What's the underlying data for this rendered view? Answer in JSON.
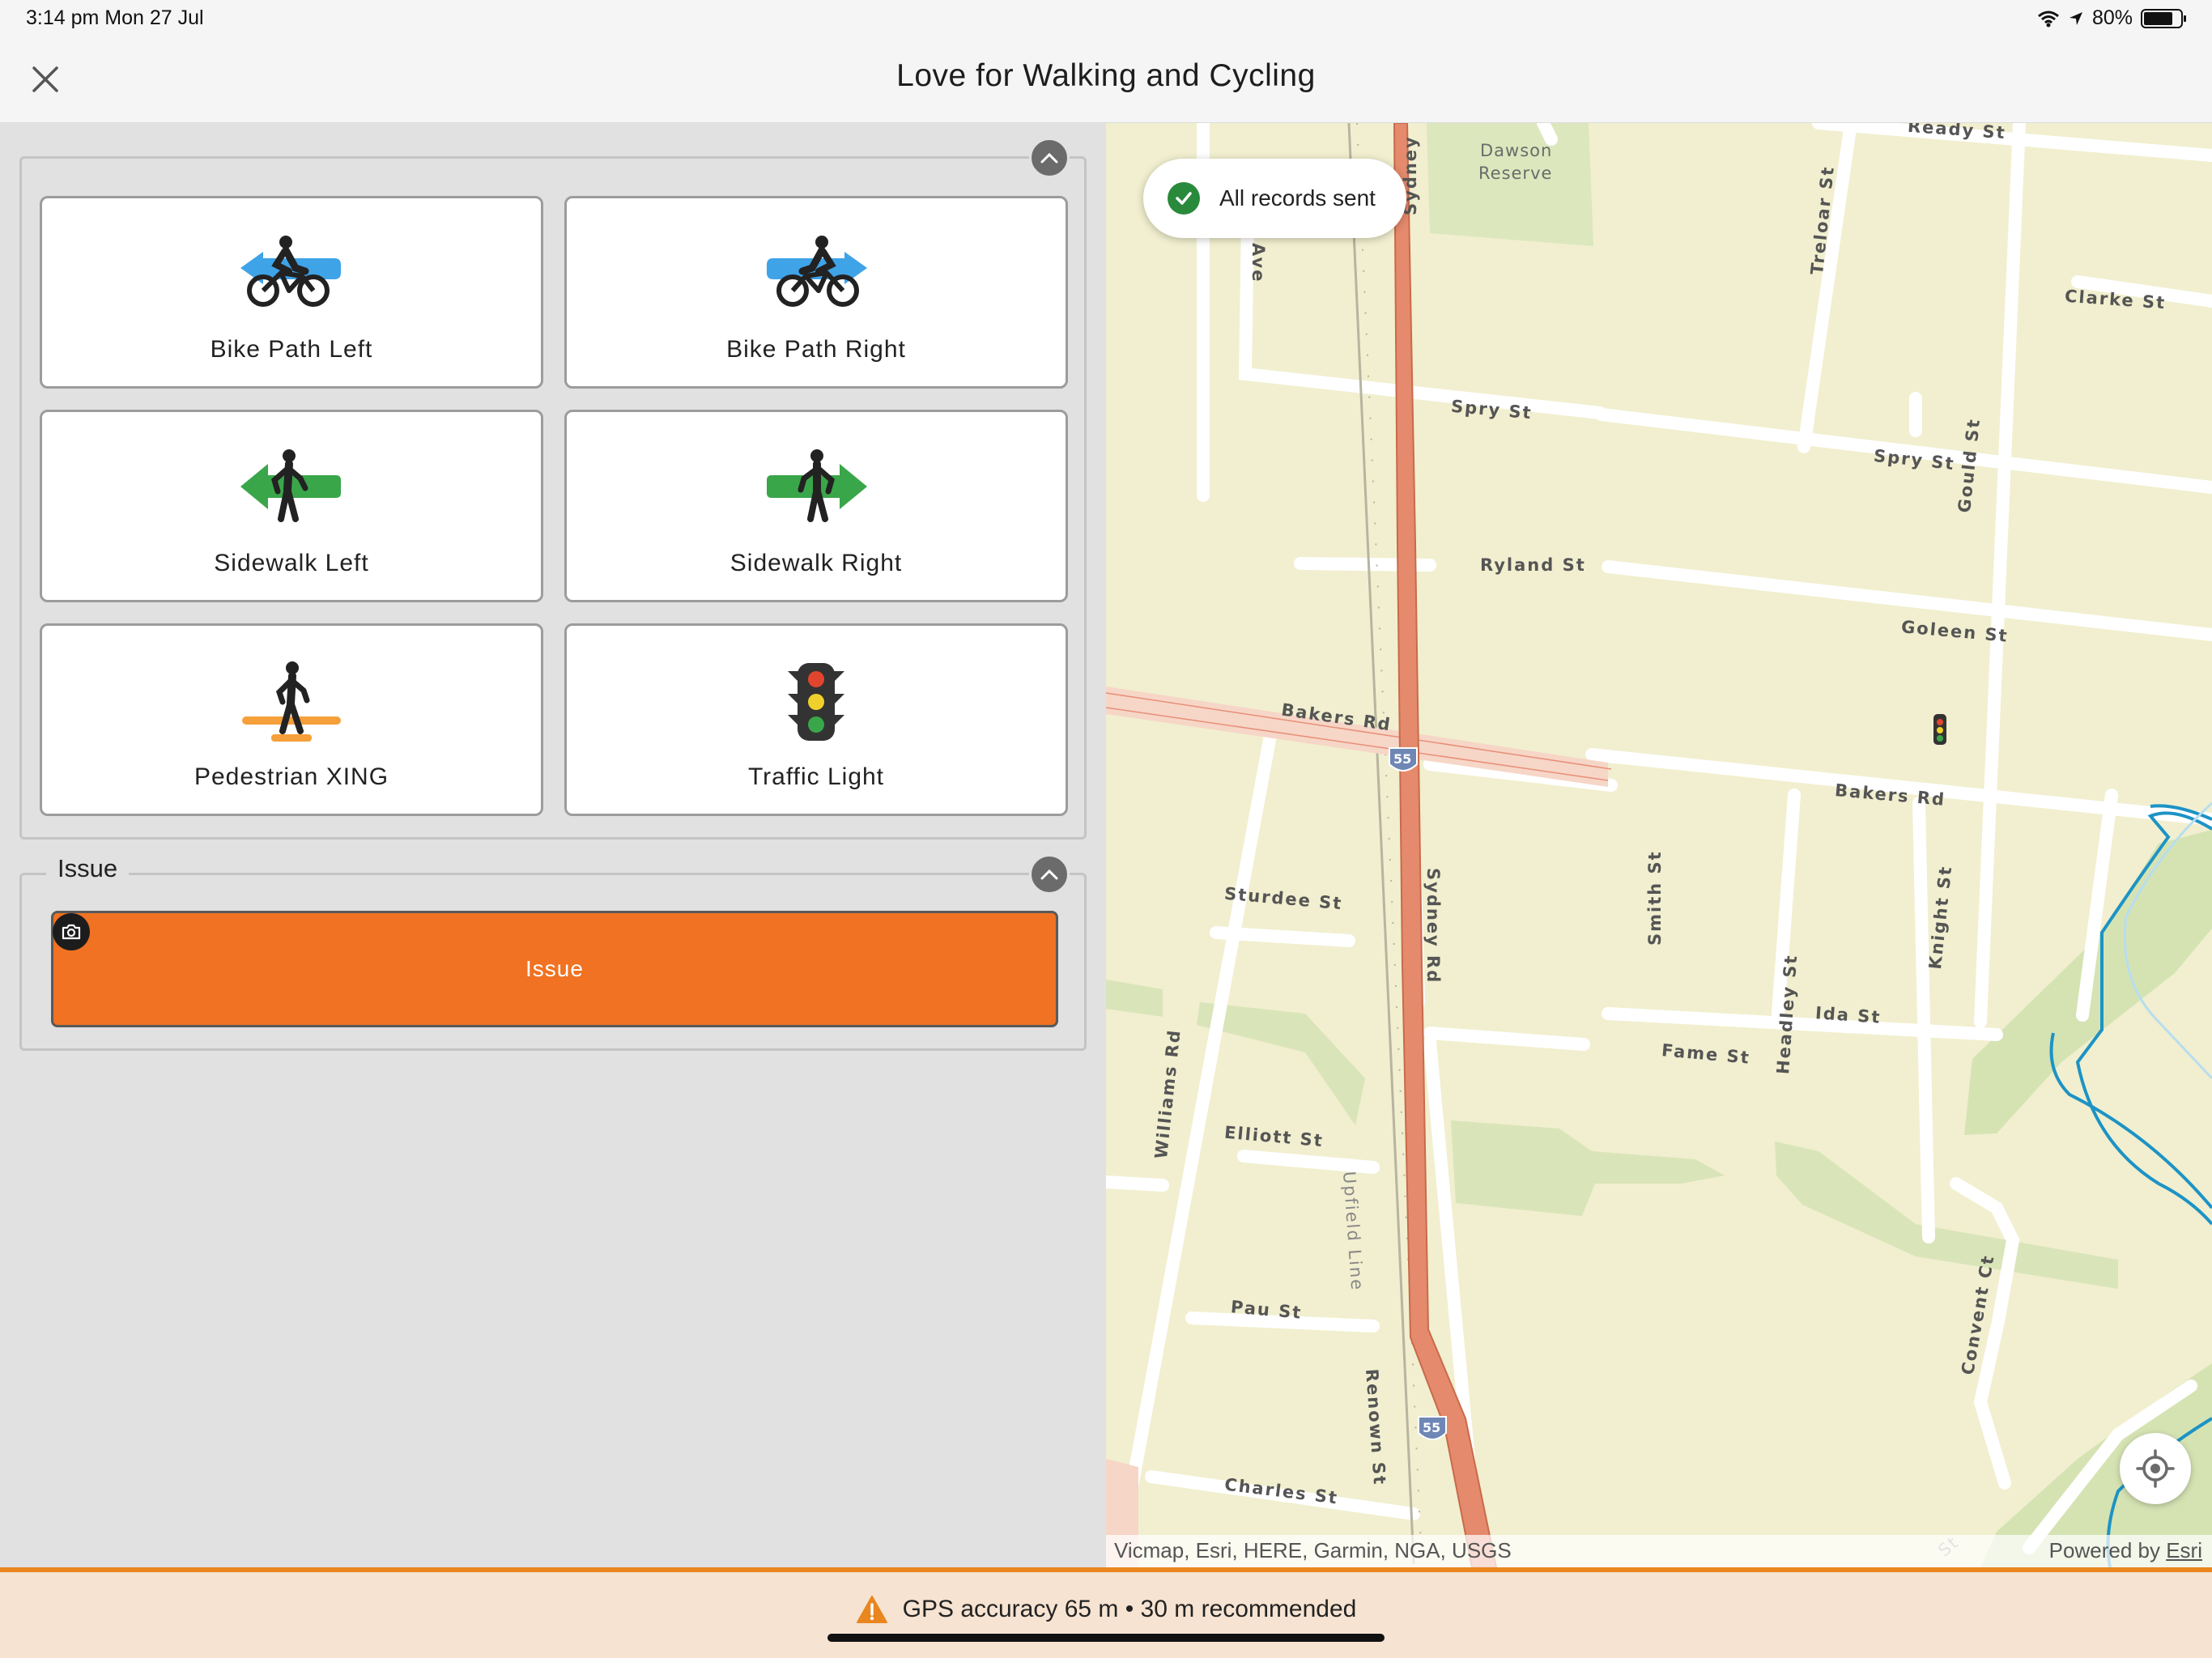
{
  "status_bar": {
    "time": "3:14 pm   Mon 27 Jul",
    "battery_text": "80%",
    "battery_level": 0.8
  },
  "header": {
    "title": "Love for Walking and Cycling",
    "close_icon": "close-icon"
  },
  "form": {
    "group1": {
      "tiles": [
        {
          "label": "Bike Path Left",
          "icon": "bike-path-left-icon"
        },
        {
          "label": "Bike Path Right",
          "icon": "bike-path-right-icon"
        },
        {
          "label": "Sidewalk Left",
          "icon": "sidewalk-left-icon"
        },
        {
          "label": "Sidewalk Right",
          "icon": "sidewalk-right-icon"
        },
        {
          "label": "Pedestrian XING",
          "icon": "pedestrian-crossing-icon"
        },
        {
          "label": "Traffic Light",
          "icon": "traffic-light-icon"
        }
      ]
    },
    "group2": {
      "title": "Issue",
      "button_label": "Issue"
    }
  },
  "map": {
    "toast": "All records sent",
    "attribution": "Vicmap, Esri, HERE, Garmin, NGA, USGS",
    "powered_by": "Powered by",
    "powered_by_link": "Esri",
    "labels": {
      "dawson": "Dawson",
      "reserve": "Reserve",
      "ready_st": "Ready St",
      "clarke_st": "Clarke St",
      "treloar_st": "Treloar St",
      "spry_st_1": "Spry St",
      "spry_st_2": "Spry St",
      "gould_st": "Gould St",
      "ryland_st": "Ryland St",
      "goleen_st": "Goleen St",
      "bakers_rd_1": "Bakers Rd",
      "bakers_rd_2": "Bakers Rd",
      "sydney_top": "Sydney",
      "sydney_rd": "Sydney Rd",
      "ave": "Ave",
      "sturdee_st": "Sturdee St",
      "smith_st": "Smith St",
      "knight_st": "Knight St",
      "headley_st": "Headley St",
      "ida_st": "Ida St",
      "fame_st": "Fame St",
      "williams_rd": "Williams Rd",
      "elliott_st": "Elliott St",
      "upfield_line": "Upfield Line",
      "pau_st": "Pau St",
      "renown_st": "Renown St",
      "charles_st": "Charles St",
      "convent_ct": "Convent Ct",
      "shield_1": "55",
      "shield_2": "55",
      "st_corner": "St"
    }
  },
  "gps": {
    "message": "GPS accuracy 65 m  •  30 m recommended"
  }
}
